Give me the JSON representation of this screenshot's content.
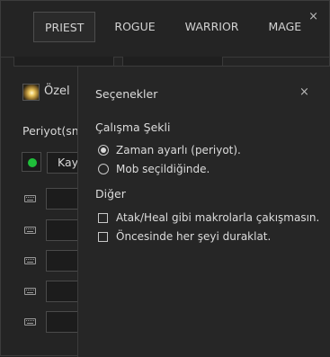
{
  "window": {
    "close": "×"
  },
  "tabs": [
    {
      "label": "PRIEST",
      "active": true
    },
    {
      "label": "ROGUE",
      "active": false
    },
    {
      "label": "WARRIOR",
      "active": false
    },
    {
      "label": "MAGE",
      "active": false
    }
  ],
  "background": {
    "ozel_label": "Özel",
    "periyot_label": "Periyot(sn)",
    "kay_value": "Kay",
    "status_color": "#1fbf3a",
    "keyboard_rows": 5,
    "icon": "keyboard-icon"
  },
  "dialog": {
    "title": "Seçenekler",
    "close": "×",
    "mode_label": "Çalışma Şekli",
    "mode_options": [
      {
        "label": "Zaman ayarlı (periyot).",
        "selected": true
      },
      {
        "label": "Mob seçildiğinde.",
        "selected": false
      }
    ],
    "other_label": "Diğer",
    "other_options": [
      {
        "label": "Atak/Heal gibi makrolarla çakışmasın.",
        "checked": false
      },
      {
        "label": "Öncesinde her şeyi duraklat.",
        "checked": false
      }
    ]
  }
}
